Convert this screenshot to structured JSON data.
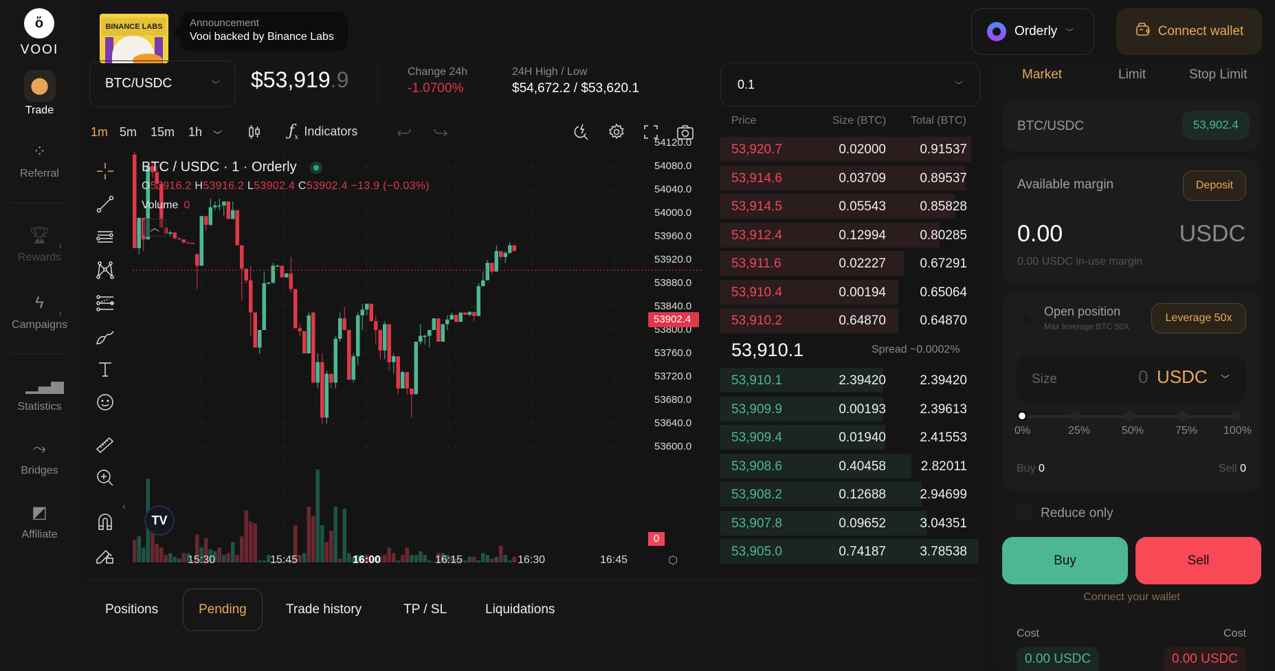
{
  "brand": {
    "name": "VOOI"
  },
  "sidebar": {
    "items": [
      {
        "label": "Trade",
        "icon": "trade-icon",
        "active": true
      },
      {
        "label": "Referral",
        "icon": "referral-icon"
      },
      {
        "label": "Rewards",
        "icon": "trophy-icon",
        "disabled": true,
        "has_submenu": true
      },
      {
        "label": "Campaigns",
        "icon": "lightning-icon",
        "has_submenu": true
      },
      {
        "label": "Statistics",
        "icon": "bar-chart-icon"
      },
      {
        "label": "Bridges",
        "icon": "route-icon"
      },
      {
        "label": "Affiliate",
        "icon": "affiliate-icon"
      }
    ]
  },
  "announcement": {
    "title": "Announcement",
    "text": "Vooi backed by Binance Labs",
    "banner_text": "BINANCE LABS"
  },
  "header": {
    "venue": "Orderly",
    "connect_wallet": "Connect wallet"
  },
  "market": {
    "pair": "BTC/USDC",
    "price_main": "$53,919",
    "price_decimal": ".9",
    "change_label": "Change 24h",
    "change_value": "-1.0700%",
    "highlow_label": "24H High / Low",
    "highlow_value": "$54,672.2 / $53,620.1"
  },
  "chart_toolbar": {
    "timeframes": [
      "1m",
      "5m",
      "15m",
      "1h"
    ],
    "active_timeframe": "1m",
    "indicators_label": "Indicators"
  },
  "colors": {
    "up": "#4db795",
    "down": "#f0465a",
    "accent": "#e8a95b",
    "vol_up": "#1d5446",
    "vol_down": "#6b2730"
  },
  "chart_data": {
    "type": "candlestick",
    "title": "BTC / USDC · 1 · Orderly",
    "legend": {
      "O": "53916.2",
      "H": "53916.2",
      "L": "53902.4",
      "C": "53902.4",
      "change": "−13.9 (−0.03%)"
    },
    "volume_label": "Volume",
    "volume_value": "0",
    "current_price": "53902.4",
    "current_volume": "0",
    "ylim": [
      53580,
      54140
    ],
    "y_ticks": [
      "54120.0",
      "54080.0",
      "54040.0",
      "54000.0",
      "53960.0",
      "53920.0",
      "53880.0",
      "53840.0",
      "53800.0",
      "53760.0",
      "53720.0",
      "53680.0",
      "53640.0",
      "53600.0"
    ],
    "x_ticks": [
      {
        "label": "15:30",
        "bold": false
      },
      {
        "label": "15:45",
        "bold": false
      },
      {
        "label": "16:00",
        "bold": true
      },
      {
        "label": "16:15",
        "bold": false
      },
      {
        "label": "16:30",
        "bold": false
      },
      {
        "label": "16:45",
        "bold": false
      }
    ],
    "candles": [
      [
        54100,
        54105,
        53940,
        53940
      ],
      [
        53940,
        53950,
        53930,
        53992
      ],
      [
        53992,
        53960,
        53935,
        53955
      ],
      [
        53955,
        54080,
        53955,
        54080
      ],
      [
        54080,
        54090,
        54060,
        54070
      ],
      [
        54070,
        54080,
        54040,
        54050
      ],
      [
        54050,
        54055,
        53975,
        53975
      ],
      [
        53975,
        53975,
        53965,
        53965
      ],
      [
        53965,
        53970,
        53960,
        53967
      ],
      [
        53967,
        53967,
        53955,
        53957
      ],
      [
        53957,
        53957,
        53957,
        53955
      ],
      [
        53955,
        53955,
        53948,
        53950
      ],
      [
        53950,
        53950,
        53949,
        53949
      ],
      [
        53949,
        53949,
        53947,
        53948
      ],
      [
        53930,
        53930,
        53870,
        53910
      ],
      [
        53910,
        53995,
        53910,
        53995
      ],
      [
        53995,
        53995,
        53970,
        53980
      ],
      [
        53980,
        54025,
        53978,
        54010
      ],
      [
        54010,
        54020,
        54005,
        54013
      ],
      [
        54013,
        54025,
        54005,
        54013
      ],
      [
        54013,
        54020,
        53995,
        54020
      ],
      [
        54020,
        54020,
        53990,
        53990
      ],
      [
        53990,
        54020,
        53990,
        54005
      ],
      [
        54005,
        54005,
        53945,
        53945
      ],
      [
        53945,
        53935,
        53850,
        53905
      ],
      [
        53905,
        53905,
        53880,
        53885
      ],
      [
        53885,
        53910,
        53790,
        53830
      ],
      [
        53830,
        53830,
        53770,
        53770
      ],
      [
        53770,
        53795,
        53760,
        53800
      ],
      [
        53800,
        53900,
        53800,
        53880
      ],
      [
        53880,
        53882,
        53878,
        53881
      ],
      [
        53881,
        53915,
        53880,
        53910
      ],
      [
        53910,
        53912,
        53908,
        53910
      ],
      [
        53910,
        53910,
        53890,
        53890
      ],
      [
        53890,
        53897,
        53895,
        53897
      ],
      [
        53897,
        53925,
        53865,
        53870
      ],
      [
        53870,
        53870,
        53803,
        53803
      ],
      [
        53803,
        53810,
        53790,
        53798
      ],
      [
        53798,
        53798,
        53760,
        53760
      ],
      [
        53760,
        53830,
        53760,
        53825
      ],
      [
        53830,
        53830,
        53710,
        53710
      ],
      [
        53710,
        53760,
        53700,
        53745
      ],
      [
        53745,
        53760,
        53640,
        53650
      ],
      [
        53650,
        53730,
        53640,
        53725
      ],
      [
        53725,
        53725,
        53700,
        53710
      ],
      [
        53710,
        53790,
        53700,
        53785
      ],
      [
        53785,
        53830,
        53780,
        53820
      ],
      [
        53820,
        53840,
        53810,
        53800
      ],
      [
        53800,
        53800,
        53715,
        53715
      ],
      [
        53715,
        53760,
        53710,
        53755
      ],
      [
        53755,
        53830,
        53740,
        53825
      ],
      [
        53825,
        53845,
        53800,
        53835
      ],
      [
        53835,
        53845,
        53825,
        53845
      ],
      [
        53845,
        53845,
        53815,
        53815
      ],
      [
        53815,
        53825,
        53775,
        53800
      ],
      [
        53800,
        53800,
        53750,
        53765
      ],
      [
        53765,
        53815,
        53750,
        53810
      ],
      [
        53810,
        53810,
        53730,
        53745
      ],
      [
        53745,
        53760,
        53725,
        53755
      ],
      [
        53755,
        53755,
        53690,
        53700
      ],
      [
        53700,
        53730,
        53700,
        53728
      ],
      [
        53728,
        53728,
        53690,
        53700
      ],
      [
        53700,
        53700,
        53650,
        53690
      ],
      [
        53690,
        53745,
        53690,
        53780
      ],
      [
        53780,
        53810,
        53775,
        53790
      ],
      [
        53790,
        53792,
        53775,
        53790
      ],
      [
        53790,
        53800,
        53770,
        53800
      ],
      [
        53800,
        53820,
        53800,
        53820
      ],
      [
        53820,
        53820,
        53780,
        53780
      ],
      [
        53780,
        53780,
        53780,
        53810
      ],
      [
        53810,
        53825,
        53800,
        53818
      ],
      [
        53818,
        53830,
        53818,
        53826
      ],
      [
        53826,
        53826,
        53812,
        53814
      ],
      [
        53814,
        53830,
        53814,
        53830
      ],
      [
        53830,
        53830,
        53826,
        53826
      ],
      [
        53826,
        53832,
        53824,
        53831
      ],
      [
        53831,
        53831,
        53815,
        53824
      ],
      [
        53824,
        53880,
        53824,
        53875
      ],
      [
        53875,
        53900,
        53875,
        53885
      ],
      [
        53885,
        53920,
        53885,
        53915
      ],
      [
        53915,
        53915,
        53895,
        53900
      ],
      [
        53900,
        53945,
        53900,
        53935
      ],
      [
        53935,
        53935,
        53920,
        53925
      ],
      [
        53925,
        53935,
        53915,
        53932
      ],
      [
        53932,
        53950,
        53930,
        53945
      ],
      [
        53945,
        53945,
        53935,
        53935
      ]
    ],
    "volumes": [
      [
        12,
        0
      ],
      [
        14,
        1
      ],
      [
        8,
        1
      ],
      [
        45,
        1
      ],
      [
        25,
        0
      ],
      [
        10,
        0
      ],
      [
        8,
        0
      ],
      [
        4,
        0
      ],
      [
        5,
        1
      ],
      [
        3,
        1
      ],
      [
        2,
        1
      ],
      [
        5,
        0
      ],
      [
        5,
        1
      ],
      [
        1,
        0
      ],
      [
        15,
        0
      ],
      [
        8,
        1
      ],
      [
        13,
        0
      ],
      [
        7,
        1
      ],
      [
        6,
        1
      ],
      [
        8,
        0
      ],
      [
        4,
        1
      ],
      [
        5,
        0
      ],
      [
        11,
        1
      ],
      [
        4,
        0
      ],
      [
        14,
        0
      ],
      [
        28,
        0
      ],
      [
        22,
        0
      ],
      [
        21,
        0
      ],
      [
        1,
        1
      ],
      [
        1,
        1
      ],
      [
        4,
        1
      ],
      [
        0,
        1
      ],
      [
        1,
        1
      ],
      [
        0,
        1
      ],
      [
        1,
        0
      ],
      [
        1,
        1
      ],
      [
        20,
        0
      ],
      [
        4,
        0
      ],
      [
        5,
        1
      ],
      [
        30,
        0
      ],
      [
        25,
        0
      ],
      [
        50,
        1
      ],
      [
        20,
        1
      ],
      [
        11,
        0
      ],
      [
        17,
        0
      ],
      [
        30,
        1
      ],
      [
        2,
        0
      ],
      [
        29,
        1
      ],
      [
        5,
        1
      ],
      [
        3,
        1
      ],
      [
        4,
        1
      ],
      [
        3,
        1
      ],
      [
        4,
        0
      ],
      [
        2,
        0
      ],
      [
        3,
        1
      ],
      [
        3,
        0
      ],
      [
        4,
        0
      ],
      [
        8,
        0
      ],
      [
        5,
        0
      ],
      [
        1,
        1
      ],
      [
        4,
        0
      ],
      [
        8,
        0
      ],
      [
        4,
        1
      ],
      [
        4,
        1
      ],
      [
        6,
        1
      ],
      [
        4,
        1
      ],
      [
        1,
        1
      ],
      [
        0,
        1
      ],
      [
        5,
        0
      ],
      [
        5,
        1
      ],
      [
        4,
        1
      ],
      [
        3,
        0
      ],
      [
        2,
        1
      ],
      [
        2,
        0
      ],
      [
        1,
        1
      ],
      [
        3,
        1
      ],
      [
        3,
        0
      ],
      [
        1,
        1
      ],
      [
        5,
        1
      ],
      [
        4,
        1
      ],
      [
        2,
        0
      ],
      [
        3,
        1
      ],
      [
        9,
        0
      ],
      [
        4,
        1
      ],
      [
        1,
        1
      ],
      [
        3,
        0
      ]
    ]
  },
  "orderbook": {
    "tick_size": "0.1",
    "headers": {
      "price": "Price",
      "size": "Size (BTC)",
      "total": "Total (BTC)"
    },
    "asks": [
      {
        "price": "53,920.7",
        "size": "0.02000",
        "total": "0.91537",
        "depth": 0.97
      },
      {
        "price": "53,914.6",
        "size": "0.03709",
        "total": "0.89537",
        "depth": 0.95
      },
      {
        "price": "53,914.5",
        "size": "0.05543",
        "total": "0.85828",
        "depth": 0.91
      },
      {
        "price": "53,912.4",
        "size": "0.12994",
        "total": "0.80285",
        "depth": 0.85
      },
      {
        "price": "53,911.6",
        "size": "0.02227",
        "total": "0.67291",
        "depth": 0.71
      },
      {
        "price": "53,910.4",
        "size": "0.00194",
        "total": "0.65064",
        "depth": 0.69
      },
      {
        "price": "53,910.2",
        "size": "0.64870",
        "total": "0.64870",
        "depth": 0.69
      }
    ],
    "mid_price": "53,910.1",
    "spread": "Spread ~0.0002%",
    "bids": [
      {
        "price": "53,910.1",
        "size": "2.39420",
        "total": "2.39420",
        "depth": 0.63
      },
      {
        "price": "53,909.9",
        "size": "0.00193",
        "total": "2.39613",
        "depth": 0.63
      },
      {
        "price": "53,909.4",
        "size": "0.01940",
        "total": "2.41553",
        "depth": 0.64
      },
      {
        "price": "53,908.6",
        "size": "0.40458",
        "total": "2.82011",
        "depth": 0.74
      },
      {
        "price": "53,908.2",
        "size": "0.12688",
        "total": "2.94699",
        "depth": 0.78
      },
      {
        "price": "53,907.8",
        "size": "0.09652",
        "total": "3.04351",
        "depth": 0.8
      },
      {
        "price": "53,905.0",
        "size": "0.74187",
        "total": "3.78538",
        "depth": 1.0
      }
    ]
  },
  "order_form": {
    "tabs": [
      "Market",
      "Limit",
      "Stop Limit"
    ],
    "active_tab": "Market",
    "pair": "BTC/USDC",
    "pair_price": "53,902.4",
    "available_margin_label": "Available margin",
    "deposit_label": "Deposit",
    "margin_value": "0.00",
    "margin_unit": "USDC",
    "in_use_margin": "0.00 USDC in-use margin",
    "open_position_label": "Open position",
    "max_leverage": "Max leverage BTC 50X",
    "leverage_button": "Leverage 50x",
    "size_label": "Size",
    "size_value": "0",
    "size_unit": "USDC",
    "slider_value_pct": 0,
    "slider_marks": [
      "0%",
      "25%",
      "50%",
      "75%",
      "100%"
    ],
    "buy_label": "Buy",
    "buy_value": "0",
    "sell_label": "Sell",
    "sell_value": "0",
    "reduce_only_label": "Reduce only",
    "reduce_only_checked": false,
    "buy_button": "Buy",
    "sell_button": "Sell",
    "connect_hint": "Connect your wallet",
    "cost_label": "Cost",
    "buy_cost_value": "0.00",
    "sell_cost_value": "0.00",
    "cost_unit": "USDC"
  },
  "bottom_tabs": {
    "tabs": [
      "Positions",
      "Pending",
      "Trade history",
      "TP / SL",
      "Liquidations"
    ],
    "active": "Pending"
  }
}
